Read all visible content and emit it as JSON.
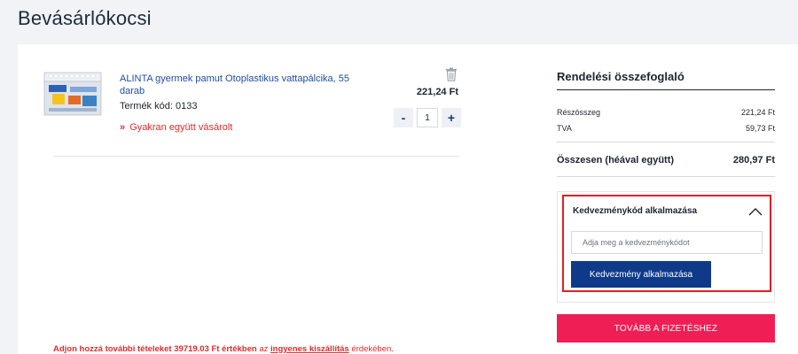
{
  "page": {
    "title": "Bevásárlókocsi"
  },
  "cart": {
    "item": {
      "name": "ALINTA gyermek pamut Otoplastikus vattapálcika, 55 darab",
      "code_label": "Termék kód: 0133",
      "price": "221,24 Ft",
      "quantity": "1",
      "minus_label": "-",
      "plus_label": "+",
      "bought_together_marker": "»",
      "bought_together": "Gyakran együtt vásárolt",
      "trash_icon": "trash-icon"
    },
    "free_shipping": {
      "prefix": "Adjon hozzá további tételeket",
      "amount": "39719.03 Ft értékben",
      "middle": "az",
      "link": "ingyenes kiszállítás",
      "suffix": "érdekében."
    }
  },
  "summary": {
    "title": "Rendelési összefoglaló",
    "subtotal_label": "Részösszeg",
    "subtotal_value": "221,24 Ft",
    "vat_label": "TVA",
    "vat_value": "59,73 Ft",
    "total_label": "Összesen (héával együtt)",
    "total_value": "280,97 Ft"
  },
  "coupon": {
    "title": "Kedvezménykód alkalmazása",
    "placeholder": "Adja meg a kedvezménykódot",
    "apply_label": "Kedvezmény alkalmazása",
    "icon": "chevron-up-icon"
  },
  "checkout": {
    "label": "TOVÁBB A FIZETÉSHEZ"
  },
  "colors": {
    "accent": "#0f3a8a",
    "checkout": "#ef1f55",
    "highlight": "#e31e24",
    "link": "#1f4fa0",
    "warning": "#e02b2b"
  }
}
